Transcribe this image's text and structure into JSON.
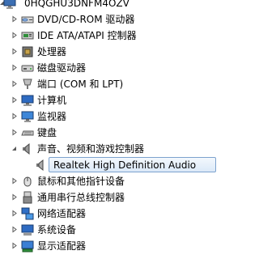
{
  "root": {
    "label": "0HQGHU3DNFM4OZV"
  },
  "categories": [
    {
      "label": "DVD/CD-ROM 驱动器",
      "icon": "dvd-drive-icon"
    },
    {
      "label": "IDE ATA/ATAPI 控制器",
      "icon": "ide-controller-icon"
    },
    {
      "label": "处理器",
      "icon": "processor-icon"
    },
    {
      "label": "磁盘驱动器",
      "icon": "disk-drive-icon"
    },
    {
      "label": "端口 (COM 和 LPT)",
      "icon": "port-icon"
    },
    {
      "label": "计算机",
      "icon": "computer-icon"
    },
    {
      "label": "监视器",
      "icon": "monitor-icon"
    },
    {
      "label": "键盘",
      "icon": "keyboard-icon"
    },
    {
      "label": "声音、视频和游戏控制器",
      "icon": "sound-icon",
      "expanded": true
    },
    {
      "label": "鼠标和其他指针设备",
      "icon": "mouse-icon"
    },
    {
      "label": "通用串行总线控制器",
      "icon": "usb-icon"
    },
    {
      "label": "网络适配器",
      "icon": "network-adapter-icon"
    },
    {
      "label": "系统设备",
      "icon": "system-device-icon"
    },
    {
      "label": "显示适配器",
      "icon": "display-adapter-icon"
    }
  ],
  "selected_child": {
    "label": "Realtek High Definition Audio",
    "icon": "speaker-icon"
  },
  "colors": {
    "selection_border": "#7da2ce",
    "selection_top": "#f3f8fd",
    "selection_bottom": "#dbe9f8",
    "expander": "#595959"
  }
}
